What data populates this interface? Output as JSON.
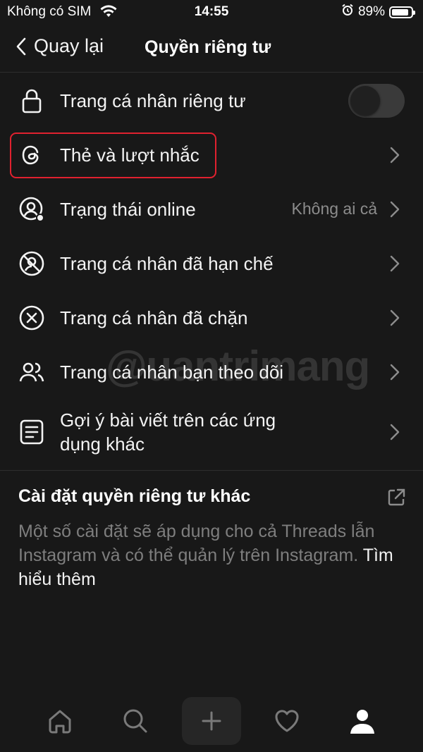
{
  "status": {
    "carrier": "Không có SIM",
    "time": "14:55",
    "battery": "89%",
    "battery_level": 0.89
  },
  "nav": {
    "back_label": "Quay lại",
    "title": "Quyền riêng tư"
  },
  "rows": [
    {
      "icon": "lock-icon",
      "label": "Trang cá nhân riêng tư",
      "toggle_on": false
    },
    {
      "icon": "threads-icon",
      "label": "Thẻ và lượt nhắc"
    },
    {
      "icon": "online-status-icon",
      "label": "Trạng thái online",
      "value": "Không ai cả"
    },
    {
      "icon": "restricted-icon",
      "label": "Trang cá nhân đã hạn chế"
    },
    {
      "icon": "blocked-icon",
      "label": "Trang cá nhân đã chặn"
    },
    {
      "icon": "people-icon",
      "label": "Trang cá nhân bạn theo dõi"
    },
    {
      "icon": "document-icon",
      "label": "Gợi ý bài viết trên các ứng dụng khác"
    }
  ],
  "other": {
    "title": "Cài đặt quyền riêng tư khác",
    "description": "Một số cài đặt sẽ áp dụng cho cả Threads lẫn Instagram và có thể quản lý trên Instagram.",
    "learn_more": "Tìm hiểu thêm"
  },
  "watermark": "@uantrimang",
  "colors": {
    "background": "#181818",
    "highlight": "#e0212f",
    "muted": "#7e7e7e"
  }
}
